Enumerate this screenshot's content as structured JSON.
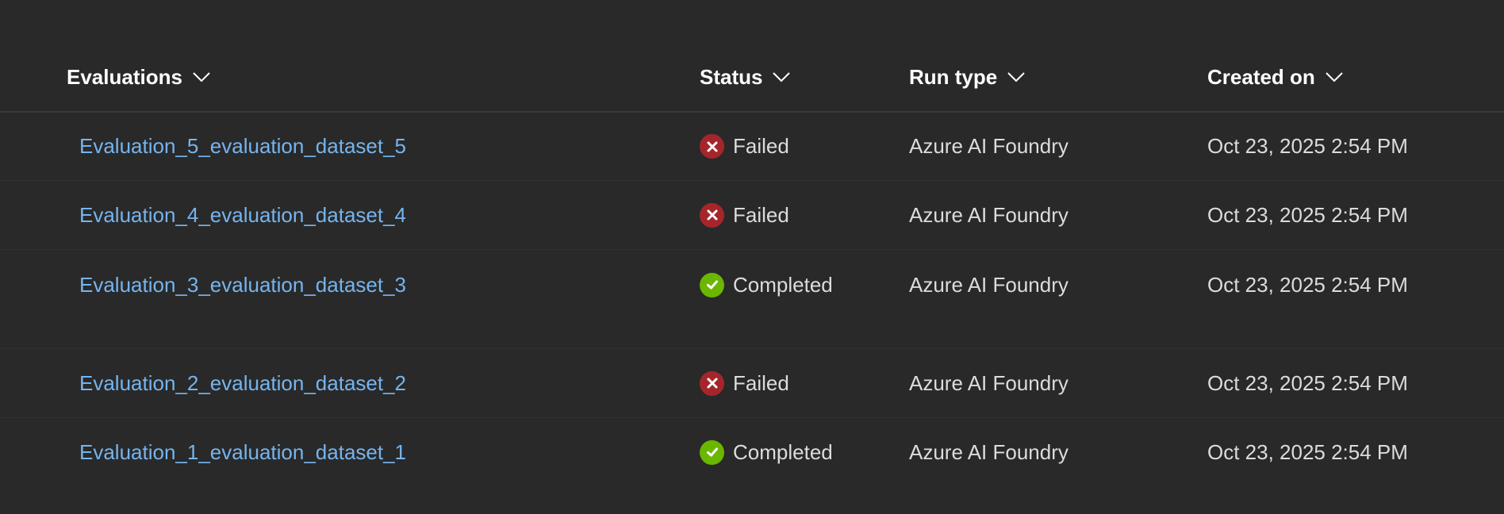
{
  "header": {
    "evaluations": "Evaluations",
    "status": "Status",
    "run_type": "Run type",
    "created_on": "Created on"
  },
  "rows": [
    {
      "name": "Evaluation_5_evaluation_dataset_5",
      "status": "Failed",
      "status_kind": "failed",
      "run_type": "Azure AI Foundry",
      "created_on": "Oct 23, 2025 2:54 PM"
    },
    {
      "name": "Evaluation_4_evaluation_dataset_4",
      "status": "Failed",
      "status_kind": "failed",
      "run_type": "Azure AI Foundry",
      "created_on": "Oct 23, 2025 2:54 PM"
    },
    {
      "name": "Evaluation_3_evaluation_dataset_3",
      "status": "Completed",
      "status_kind": "completed",
      "run_type": "Azure AI Foundry",
      "created_on": "Oct 23, 2025 2:54 PM"
    },
    {
      "name": "Evaluation_2_evaluation_dataset_2",
      "status": "Failed",
      "status_kind": "failed",
      "run_type": "Azure AI Foundry",
      "created_on": "Oct 23, 2025 2:54 PM"
    },
    {
      "name": "Evaluation_1_evaluation_dataset_1",
      "status": "Completed",
      "status_kind": "completed",
      "run_type": "Azure AI Foundry",
      "created_on": "Oct 23, 2025 2:54 PM"
    }
  ],
  "colors": {
    "background": "#292929",
    "link": "#76b4ee",
    "failed": "#a4262c",
    "completed": "#6bb700"
  },
  "icons": {
    "sort": "chevron-down-icon",
    "failed": "error-circle-icon",
    "completed": "checkmark-circle-icon"
  }
}
